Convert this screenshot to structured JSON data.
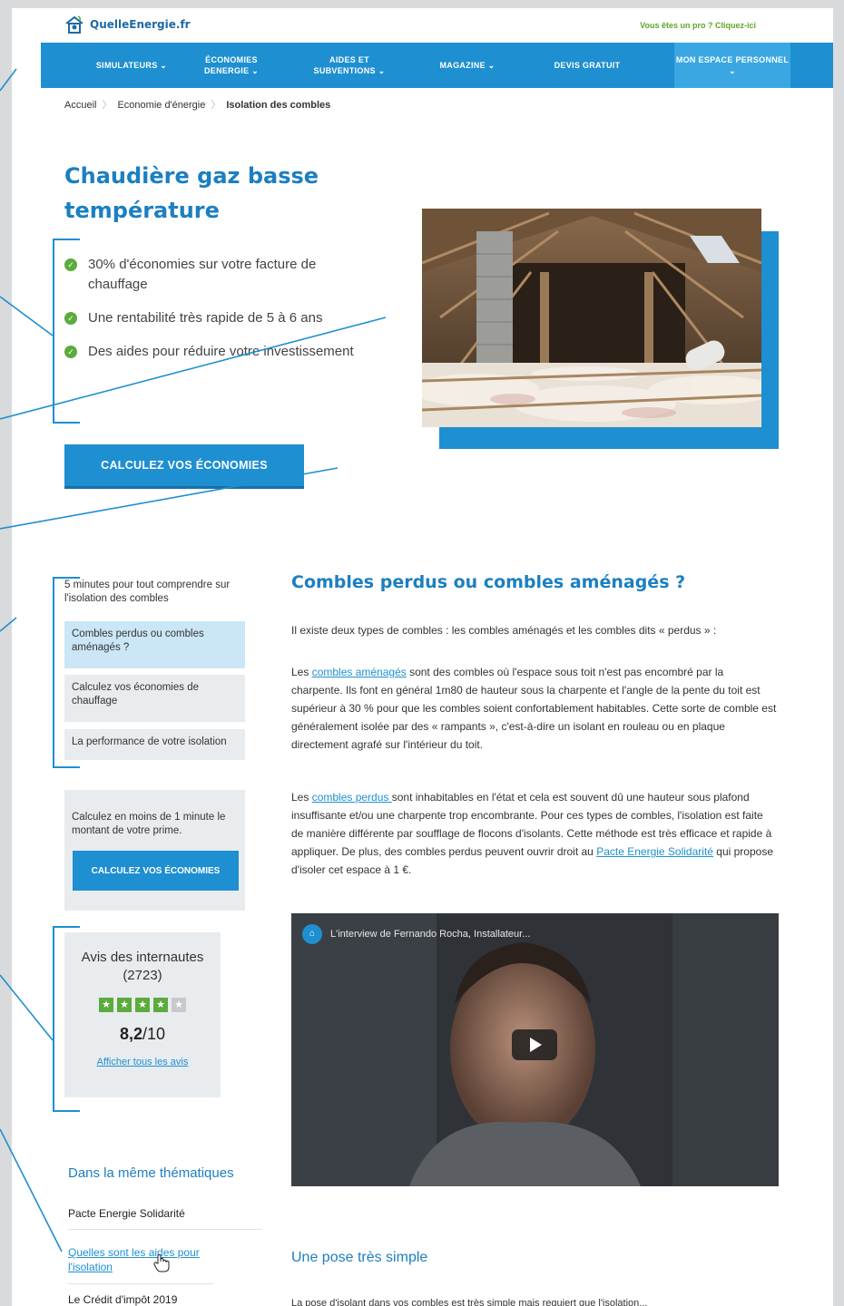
{
  "header": {
    "logo_text": "QuelleEnergie.fr",
    "pro_link": "Vous êtes un pro ? Cliquez-ici"
  },
  "nav": [
    {
      "label": "SIMULATEURS ⌄"
    },
    {
      "label": "ÉCONOMIES DENERGIE ⌄"
    },
    {
      "label": "AIDES ET SUBVENTIONS ⌄"
    },
    {
      "label": "MAGAZINE ⌄"
    },
    {
      "label": "DEVIS GRATUIT"
    },
    {
      "label": "MON ESPACE PERSONNEL ⌄"
    }
  ],
  "breadcrumb": {
    "home": "Accueil",
    "section": "Economie d'énergie",
    "current": "Isolation des combles",
    "separator": "〉"
  },
  "hero": {
    "title": "Chaudière gaz basse température",
    "bullets": [
      "30% d'économies sur votre facture de chauffage",
      "Une rentabilité très rapide de 5 à 6 ans",
      "Des aides pour réduire votre investissement"
    ],
    "cta": "CALCULEZ VOS ÉCONOMIES"
  },
  "toc": {
    "title": "5 minutes pour tout comprendre sur l'isolation des combles",
    "items": [
      "Combles perdus ou combles aménagés ?",
      "Calculez vos économies de chauffage",
      "La performance de votre isolation"
    ]
  },
  "calc": {
    "text": "Calculez en moins de 1 minute le montant de votre prime.",
    "button": "CALCULEZ VOS ÉCONOMIES"
  },
  "reviews": {
    "title": "Avis des internautes",
    "count": "(2723)",
    "rating": 4,
    "rating_max": 5,
    "score_main": "8,2",
    "score_suffix": "/10",
    "link": "Afficher tous les avis"
  },
  "related": {
    "title": "Dans la même thématiques",
    "items": [
      "Pacte Energie Solidarité",
      "Quelles sont les aides pour l'isolation",
      "Le Crédit d'impôt 2019"
    ]
  },
  "article": {
    "h2": "Combles perdus ou combles aménagés ?",
    "intro": "Il existe deux types de combles : les combles aménagés et les combles dits « perdus » :",
    "p1_pre": "Les ",
    "p1_link": "combles aménagés",
    "p1_rest": " sont des combles où l'espace sous toit n'est pas encombré par la charpente. Ils font en général 1m80 de hauteur sous la charpente et l'angle de la pente du toit est supérieur à 30 % pour que les combles soient confortablement habitables. Cette sorte de comble est généralement isolée par des « rampants », c'est-à-dire un isolant en rouleau ou en plaque directement agrafé sur l'intérieur du toit.",
    "p2_pre": "Les ",
    "p2_link": "combles perdus ",
    "p2_mid": "sont inhabitables en l'état et cela est souvent dû une hauteur sous plafond insuffisante et/ou une charpente trop encombrante. Pour ces types de combles, l'isolation est faite de manière différente par soufflage de flocons d'isolants. Cette méthode est très efficace et rapide à appliquer. De plus, des combles perdus peuvent ouvrir droit au ",
    "p2_link2": "Pacte Energie Solidarité",
    "p2_end": " qui propose d'isoler cet espace à 1 €.",
    "video_title": "L'interview de Fernando Rocha, Installateur...",
    "h3": "Une pose très simple",
    "tail": "La pose d'isolant dans vos combles est très simple mais requiert que l'isolation..."
  },
  "colors": {
    "primary": "#1e8fd1",
    "title_blue": "#1c7fc1",
    "green": "#5cab3d",
    "panel_grey": "#e9ecef"
  }
}
